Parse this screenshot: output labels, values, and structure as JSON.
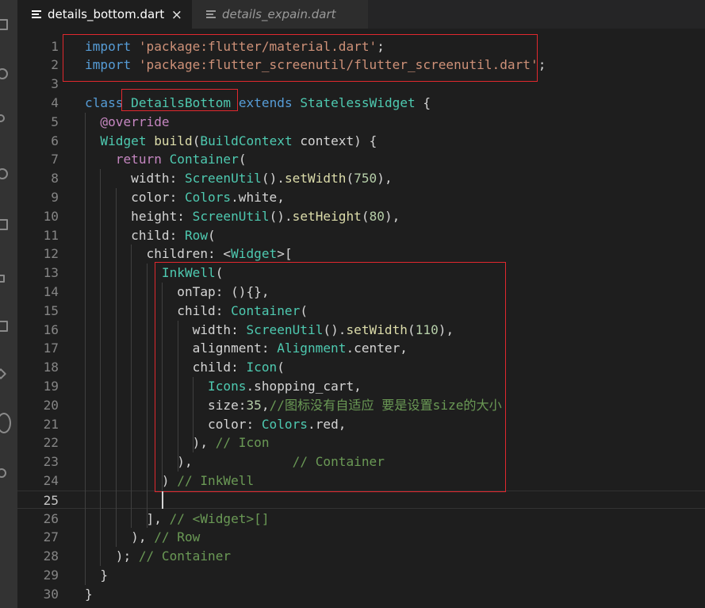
{
  "tabs": [
    {
      "name": "details_bottom.dart",
      "active": true,
      "close_icon": "close-icon",
      "glyph": "×"
    },
    {
      "name": "details_expain.dart",
      "active": false
    }
  ],
  "editor": {
    "current_line": 25,
    "lines": [
      {
        "n": 1,
        "tokens": [
          [
            "kw",
            "import"
          ],
          [
            "t",
            " "
          ],
          [
            "str",
            "'package:flutter/material.dart'"
          ],
          [
            "t",
            ";"
          ]
        ]
      },
      {
        "n": 2,
        "tokens": [
          [
            "kw",
            "import"
          ],
          [
            "t",
            " "
          ],
          [
            "str",
            "'package:flutter_screenutil/flutter_screenutil.dart'"
          ],
          [
            "t",
            ";"
          ]
        ]
      },
      {
        "n": 3,
        "tokens": []
      },
      {
        "n": 4,
        "tokens": [
          [
            "kw",
            "class"
          ],
          [
            "t",
            " "
          ],
          [
            "cls",
            "DetailsBottom"
          ],
          [
            "t",
            " "
          ],
          [
            "kw",
            "extends"
          ],
          [
            "t",
            " "
          ],
          [
            "cls",
            "StatelessWidget"
          ],
          [
            "t",
            " {"
          ]
        ]
      },
      {
        "n": 5,
        "tokens": [
          [
            "t",
            "  "
          ],
          [
            "ann",
            "@override"
          ]
        ]
      },
      {
        "n": 6,
        "tokens": [
          [
            "t",
            "  "
          ],
          [
            "cls",
            "Widget"
          ],
          [
            "t",
            " "
          ],
          [
            "fn",
            "build"
          ],
          [
            "t",
            "("
          ],
          [
            "cls",
            "BuildContext"
          ],
          [
            "t",
            " context) {"
          ]
        ]
      },
      {
        "n": 7,
        "tokens": [
          [
            "t",
            "    "
          ],
          [
            "ann",
            "return"
          ],
          [
            "t",
            " "
          ],
          [
            "cls",
            "Container"
          ],
          [
            "t",
            "("
          ]
        ]
      },
      {
        "n": 8,
        "tokens": [
          [
            "t",
            "      width: "
          ],
          [
            "cls",
            "ScreenUtil"
          ],
          [
            "t",
            "()."
          ],
          [
            "fn",
            "setWidth"
          ],
          [
            "t",
            "("
          ],
          [
            "num",
            "750"
          ],
          [
            "t",
            "),"
          ]
        ]
      },
      {
        "n": 9,
        "tokens": [
          [
            "t",
            "      color: "
          ],
          [
            "cls",
            "Colors"
          ],
          [
            "t",
            ".white,"
          ]
        ]
      },
      {
        "n": 10,
        "tokens": [
          [
            "t",
            "      height: "
          ],
          [
            "cls",
            "ScreenUtil"
          ],
          [
            "t",
            "()."
          ],
          [
            "fn",
            "setHeight"
          ],
          [
            "t",
            "("
          ],
          [
            "num",
            "80"
          ],
          [
            "t",
            "),"
          ]
        ]
      },
      {
        "n": 11,
        "tokens": [
          [
            "t",
            "      child: "
          ],
          [
            "cls",
            "Row"
          ],
          [
            "t",
            "("
          ]
        ]
      },
      {
        "n": 12,
        "tokens": [
          [
            "t",
            "        children: <"
          ],
          [
            "cls",
            "Widget"
          ],
          [
            "t",
            ">["
          ]
        ]
      },
      {
        "n": 13,
        "tokens": [
          [
            "t",
            "          "
          ],
          [
            "cls",
            "InkWell"
          ],
          [
            "t",
            "("
          ]
        ]
      },
      {
        "n": 14,
        "tokens": [
          [
            "t",
            "            onTap: (){},"
          ]
        ]
      },
      {
        "n": 15,
        "tokens": [
          [
            "t",
            "            child: "
          ],
          [
            "cls",
            "Container"
          ],
          [
            "t",
            "("
          ]
        ]
      },
      {
        "n": 16,
        "tokens": [
          [
            "t",
            "              width: "
          ],
          [
            "cls",
            "ScreenUtil"
          ],
          [
            "t",
            "()."
          ],
          [
            "fn",
            "setWidth"
          ],
          [
            "t",
            "("
          ],
          [
            "num",
            "110"
          ],
          [
            "t",
            "),"
          ]
        ]
      },
      {
        "n": 17,
        "tokens": [
          [
            "t",
            "              alignment: "
          ],
          [
            "cls",
            "Alignment"
          ],
          [
            "t",
            ".center,"
          ]
        ]
      },
      {
        "n": 18,
        "tokens": [
          [
            "t",
            "              child: "
          ],
          [
            "cls",
            "Icon"
          ],
          [
            "t",
            "("
          ]
        ]
      },
      {
        "n": 19,
        "tokens": [
          [
            "t",
            "                "
          ],
          [
            "cls",
            "Icons"
          ],
          [
            "t",
            ".shopping_cart,"
          ]
        ]
      },
      {
        "n": 20,
        "tokens": [
          [
            "t",
            "                size:"
          ],
          [
            "num",
            "35"
          ],
          [
            "t",
            ","
          ],
          [
            "cmt",
            "//图标没有自适应 要是设置size的大小"
          ]
        ]
      },
      {
        "n": 21,
        "tokens": [
          [
            "t",
            "                color: "
          ],
          [
            "cls",
            "Colors"
          ],
          [
            "t",
            ".red,"
          ]
        ]
      },
      {
        "n": 22,
        "tokens": [
          [
            "t",
            "              ), "
          ],
          [
            "cmt",
            "// Icon"
          ]
        ]
      },
      {
        "n": 23,
        "tokens": [
          [
            "t",
            "            ),             "
          ],
          [
            "cmt",
            "// Container"
          ]
        ]
      },
      {
        "n": 24,
        "tokens": [
          [
            "t",
            "          ) "
          ],
          [
            "cmt",
            "// InkWell"
          ]
        ]
      },
      {
        "n": 25,
        "tokens": []
      },
      {
        "n": 26,
        "tokens": [
          [
            "t",
            "        ], "
          ],
          [
            "cmt",
            "// <Widget>[]"
          ]
        ]
      },
      {
        "n": 27,
        "tokens": [
          [
            "t",
            "      ), "
          ],
          [
            "cmt",
            "// Row"
          ]
        ]
      },
      {
        "n": 28,
        "tokens": [
          [
            "t",
            "    ); "
          ],
          [
            "cmt",
            "// Container"
          ]
        ]
      },
      {
        "n": 29,
        "tokens": [
          [
            "t",
            "  }"
          ]
        ]
      },
      {
        "n": 30,
        "tokens": [
          [
            "t",
            "}"
          ]
        ]
      }
    ]
  },
  "activity_icons": [
    "explorer-icon",
    "search-icon",
    "source-control-icon",
    "debug-icon",
    "extensions-icon",
    "flask-icon",
    "book-icon",
    "arrow-icon",
    "circle-icon",
    "gear-icon"
  ],
  "colors": {
    "annotation_box": "#e0282e",
    "background": "#1e1e1e",
    "keyword": "#569cd6",
    "string": "#ce9178",
    "class": "#4ec9b0",
    "comment": "#6a9955"
  }
}
